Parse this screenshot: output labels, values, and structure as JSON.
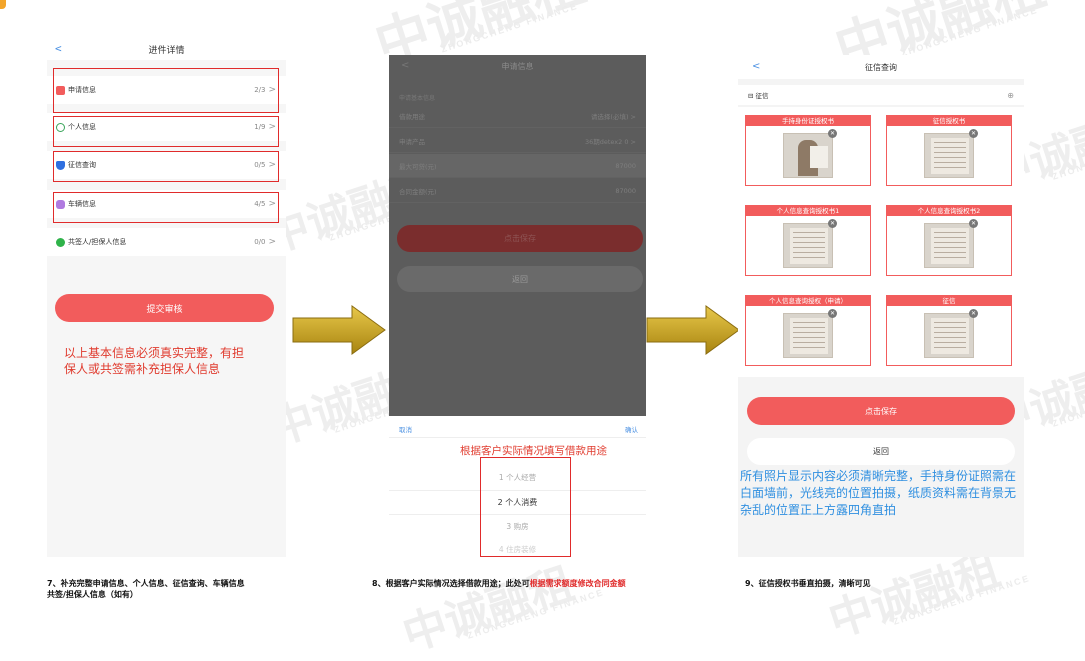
{
  "watermark": {
    "text": "中诚融租",
    "sub": "ZHONGCHENG FINANCE"
  },
  "panel1": {
    "title": "进件详情",
    "back": "<",
    "rows": [
      {
        "label": "申请信息",
        "count": "2/3",
        "icon": "apply-doc-icon",
        "color": "#f25c5c"
      },
      {
        "label": "个人信息",
        "count": "1/9",
        "icon": "person-icon",
        "color": "#3aa55b"
      },
      {
        "label": "征信查询",
        "count": "0/5",
        "icon": "shield-icon",
        "color": "#2f6fe0"
      },
      {
        "label": "车辆信息",
        "count": "4/5",
        "icon": "car-icon",
        "color": "#b07ae0"
      },
      {
        "label": "共签人/担保人信息",
        "count": "0/0",
        "icon": "co-signer-icon",
        "color": "#2fb34a"
      }
    ],
    "chevron": ">",
    "submit": "提交审核",
    "note": "以上基本信息必须真实完整，有担保人或共签需补充担保人信息"
  },
  "panel2": {
    "title": "申请信息",
    "back": "<",
    "section": "申请基本信息",
    "fields": [
      {
        "label": "借款用途",
        "value": "请选择(必填)  >"
      },
      {
        "label": "申请产品",
        "value": "36期detex2 0  >"
      },
      {
        "label": "最大可贷(元)",
        "value": "87000"
      },
      {
        "label": "合同金额(元)",
        "value": "87000"
      }
    ],
    "save": "点击保存",
    "return": "返回",
    "cancel": "取消",
    "confirm": "确认",
    "tip": "根据客户实际情况填写借款用途",
    "options": [
      "1 个人经营",
      "2 个人消费",
      "3 购房",
      "4 住房装修"
    ]
  },
  "panel3": {
    "title": "征信查询",
    "back": "<",
    "section": "征信",
    "section_action": "⊕",
    "cards": [
      {
        "title": "手持身份证授权书",
        "kind": "person"
      },
      {
        "title": "征信授权书",
        "kind": "doc"
      },
      {
        "title": "个人信息查询授权书1",
        "kind": "doc"
      },
      {
        "title": "个人信息查询授权书2",
        "kind": "doc"
      },
      {
        "title": "个人信息查询授权（申请）",
        "kind": "doc"
      },
      {
        "title": "征信",
        "kind": "doc"
      }
    ],
    "save": "点击保存",
    "return": "返回",
    "note": "所有照片显示内容必须清晰完整，手持身份证照需在白面墙前，光线亮的位置拍摄，纸质资料需在背景无杂乱的位置正上方露四角直拍"
  },
  "captions": {
    "c7a": "7、补充完整申请信息、个人信息、征信查询、车辆信息",
    "c7b": "共签/担保人信息（如有）",
    "c8a": "8、根据客户实际情况选择借款用途；此处可",
    "c8b": "根据需求额度修改合同金额",
    "c9": "9、征信授权书垂直拍摄，清晰可见"
  },
  "colors": {
    "accent": "#f25c5c",
    "highlight": "#e02b2b",
    "note_blue": "#2f8fe0",
    "arrow": "#c8a21a"
  }
}
